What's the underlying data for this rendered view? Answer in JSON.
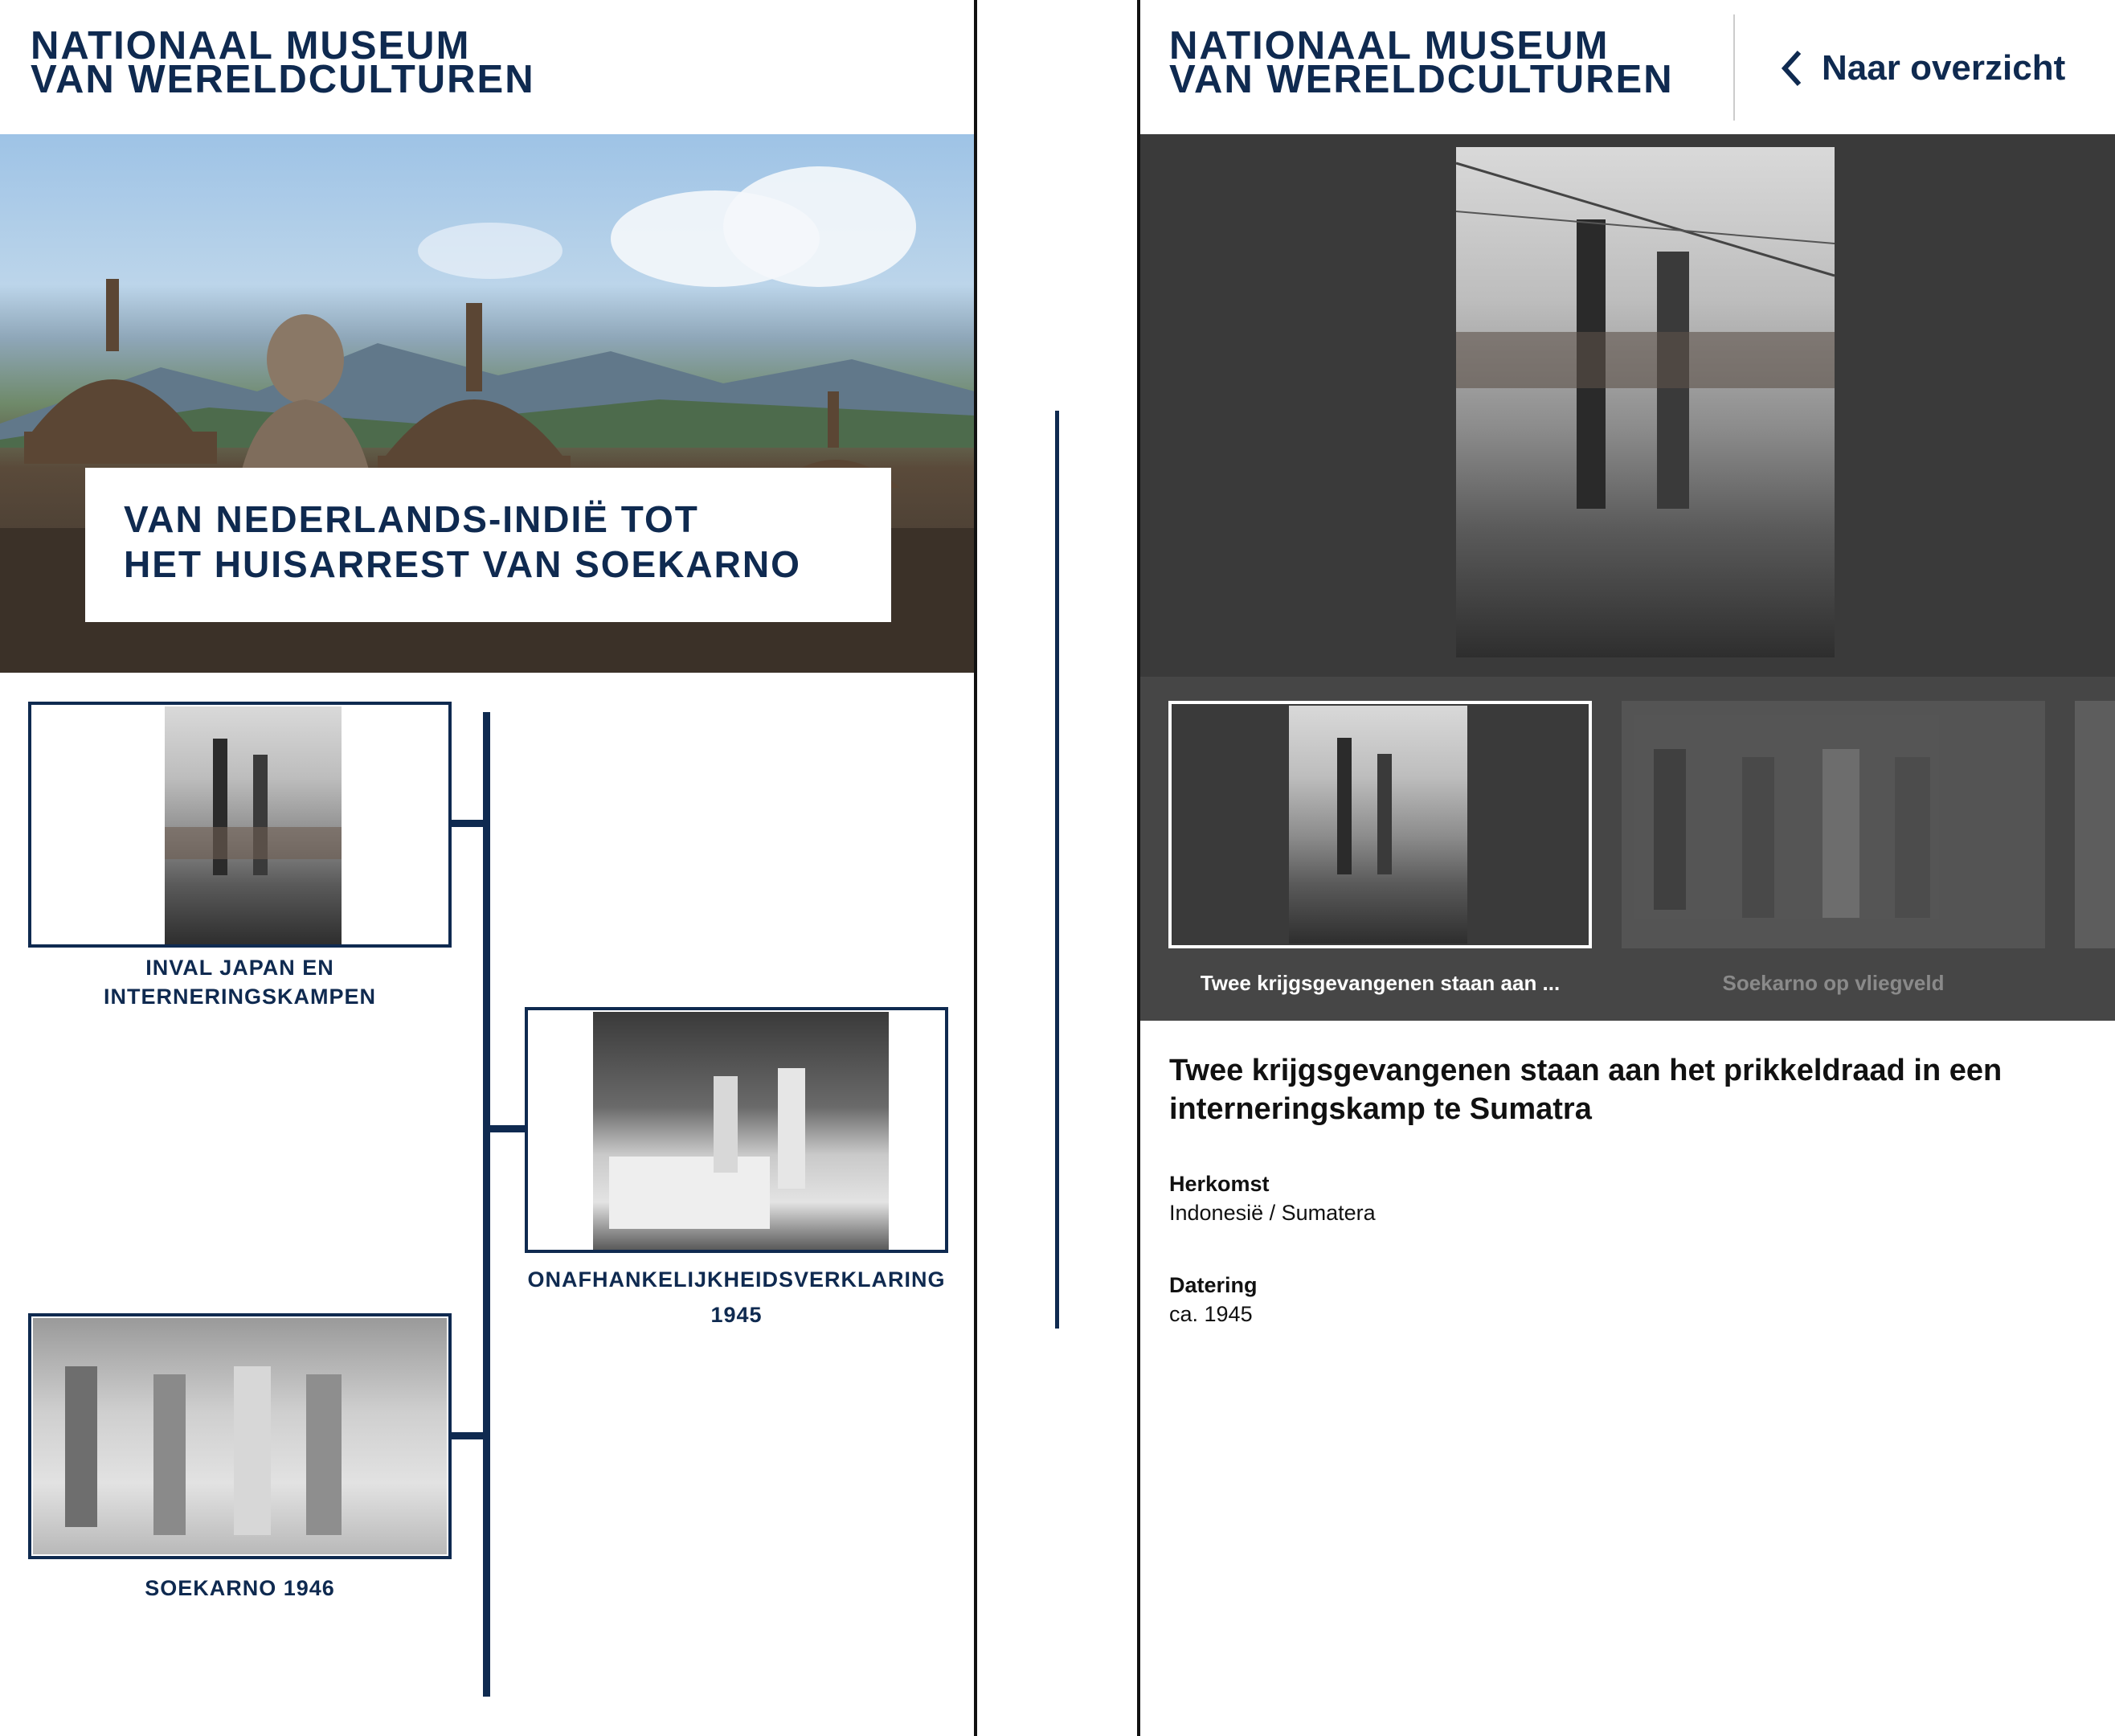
{
  "left": {
    "logo": {
      "line1": "NATIONAAL MUSEUM",
      "line2": "VAN WERELDCULTUREN"
    },
    "hero_title": {
      "line1": "VAN NEDERLANDS-INDIË TOT",
      "line2": "HET HUISARREST VAN SOEKARNO"
    },
    "timeline": [
      {
        "line1": "INVAL JAPAN EN",
        "line2": "INTERNERINGSKAMPEN"
      },
      {
        "line1": "ONAFHANKELIJKHEIDSVERKLARING",
        "line2": "1945"
      },
      {
        "line1": "SOEKARNO 1946",
        "line2": ""
      }
    ]
  },
  "right": {
    "logo": {
      "line1": "NATIONAAL MUSEUM",
      "line2": "VAN WERELDCULTUREN"
    },
    "back_label": "Naar overzicht",
    "thumbnails": [
      {
        "caption": "Twee krijgsgevangenen staan aan ..."
      },
      {
        "caption": "Soekarno op vliegveld"
      }
    ],
    "detail": {
      "title_line1": "Twee krijgsgevangenen staan aan het prikkeldraad in een",
      "title_line2": "interneringskamp te Sumatra",
      "origin_label": "Herkomst",
      "origin_value": "Indonesië / Sumatera",
      "date_label": "Datering",
      "date_value": "ca. 1945"
    }
  },
  "colors": {
    "navy": "#0f2a50",
    "dark_panel": "#3a3a3a",
    "muted_caption": "#8a8a8a"
  }
}
